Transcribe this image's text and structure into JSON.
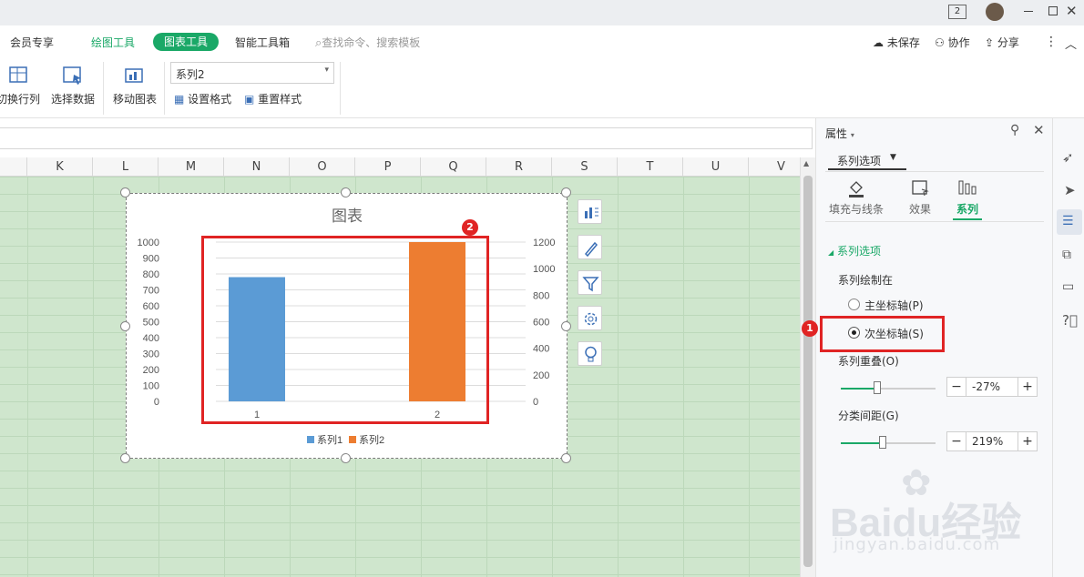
{
  "titlebar": {
    "page_badge": "2"
  },
  "menubar": {
    "items": [
      "会员专享",
      "绘图工具",
      "图表工具",
      "智能工具箱"
    ],
    "active_tab": "图表工具",
    "search_placeholder": "查找命令、搜索模板",
    "unsaved": "未保存",
    "collab": "协作",
    "share": "分享"
  },
  "ribbon": {
    "switch_rowcol": "切换行列",
    "select_data": "选择数据",
    "move_chart": "移动图表",
    "series_select": "系列2",
    "set_format": "设置格式",
    "reset_style": "重置样式"
  },
  "grid": {
    "columns": [
      "K",
      "L",
      "M",
      "N",
      "O",
      "P",
      "Q",
      "R",
      "S",
      "T",
      "U",
      "V"
    ]
  },
  "chart_data": {
    "type": "bar",
    "title": "图表",
    "categories": [
      "1",
      "2"
    ],
    "series": [
      {
        "name": "系列1",
        "axis": "primary",
        "color": "#5b9bd5",
        "values": [
          780,
          0
        ]
      },
      {
        "name": "系列2",
        "axis": "secondary",
        "color": "#ed7d31",
        "values": [
          0,
          1200
        ]
      }
    ],
    "primary_ylim": [
      0,
      1000
    ],
    "primary_ticks": [
      "0",
      "100",
      "200",
      "300",
      "400",
      "500",
      "600",
      "700",
      "800",
      "900",
      "1000"
    ],
    "secondary_ylim": [
      0,
      1200
    ],
    "secondary_ticks": [
      "0",
      "200",
      "400",
      "600",
      "800",
      "1000",
      "1200"
    ],
    "legend_position": "bottom",
    "grid": true
  },
  "panel": {
    "title": "属性",
    "dropdown": "系列选项",
    "tabs": [
      "填充与线条",
      "效果",
      "系列"
    ],
    "active_tab": "系列",
    "section": "系列选项",
    "plot_on_label": "系列绘制在",
    "radio_primary": "主坐标轴(P)",
    "radio_secondary": "次坐标轴(S)",
    "overlap_label": "系列重叠(O)",
    "overlap_value": "-27%",
    "overlap_fraction": 0.38,
    "gap_label": "分类间距(G)",
    "gap_value": "219%",
    "gap_fraction": 0.44
  },
  "annotations": {
    "badge1": "1",
    "badge2": "2"
  },
  "watermark": {
    "brand": "Baidu经验",
    "url": "jingyan.baidu.com"
  },
  "colors": {
    "accent": "#1aa867",
    "grid_bg": "#cfe6cd",
    "highlight": "#e02424",
    "series1": "#5b9bd5",
    "series2": "#ed7d31"
  }
}
